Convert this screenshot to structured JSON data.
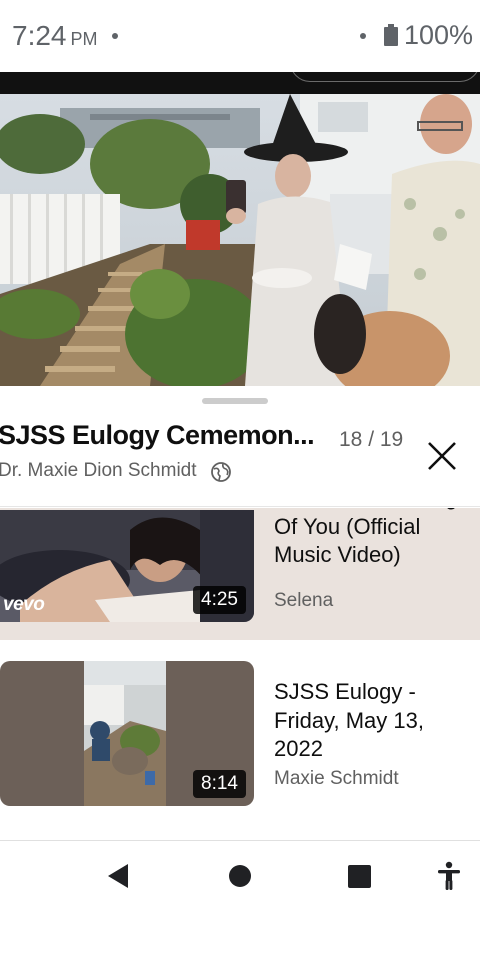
{
  "status_bar": {
    "time": "7:24",
    "ampm": "PM",
    "battery": "100%"
  },
  "player": {
    "description": "outdoor eulogy scene"
  },
  "sheet": {
    "title": "SJSS Eulogy Cememon...",
    "channel": "Dr. Maxie Dion Schmidt",
    "position": "18 / 19"
  },
  "playlist": {
    "items": [
      {
        "title": "Selena - Dreaming Of You (Official Music Video)",
        "channel": "Selena",
        "duration": "4:25",
        "badge": "vevo"
      },
      {
        "title": "SJSS Eulogy - Friday, May 13, 2022",
        "channel": "Maxie Schmidt",
        "duration": "8:14"
      }
    ]
  },
  "icons": {
    "close": "close-icon",
    "globe": "globe-icon",
    "back": "back-icon",
    "home": "home-icon",
    "recents": "recents-icon",
    "accessibility": "accessibility-icon"
  },
  "colors": {
    "active_item_bg": "#eae2dd",
    "text_primary": "#0f0f0f",
    "text_secondary": "#606060"
  }
}
